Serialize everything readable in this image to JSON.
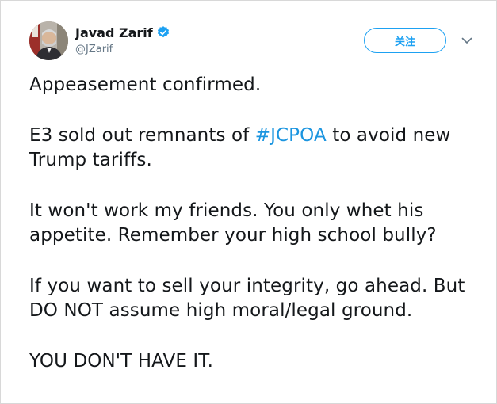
{
  "author": {
    "display_name": "Javad Zarif",
    "handle": "@JZarif",
    "verified_icon": "verified-badge-icon"
  },
  "actions": {
    "follow_label": "关注",
    "more_icon": "chevron-down-icon"
  },
  "tweet": {
    "line_1": "Appeasement confirmed.",
    "p2_before": "E3 sold out remnants of ",
    "p2_hashtag": "#JCPOA",
    "p2_after": " to avoid new Trump tariffs.",
    "line_3": "It won't work my friends. You only whet his appetite. Remember your high school bully?",
    "line_4": "If you want to sell your integrity, go ahead. But DO NOT assume high moral/legal ground.",
    "line_5": "YOU DON'T HAVE IT."
  },
  "colors": {
    "accent": "#1da1f2",
    "hashtag": "#1b95e0",
    "text": "#14171a",
    "secondary": "#657786"
  }
}
